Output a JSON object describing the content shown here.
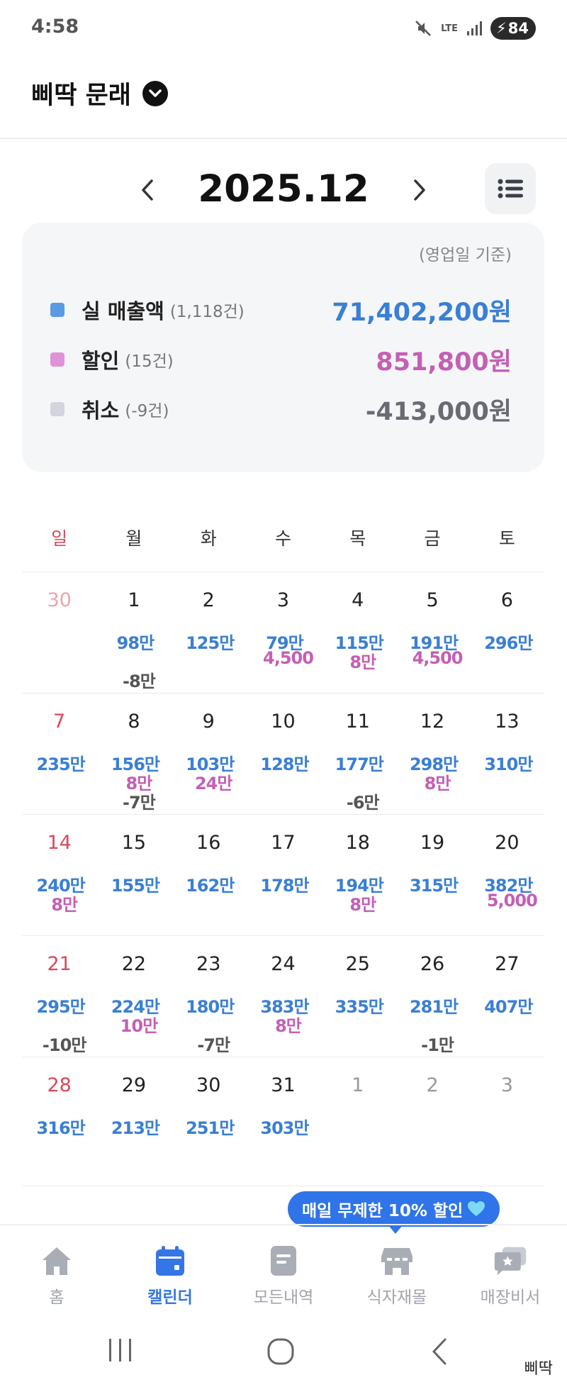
{
  "status": {
    "time": "4:58",
    "network": "LTE",
    "battery": "84"
  },
  "header": {
    "store_name": "삐딱 문래"
  },
  "month_nav": {
    "title": "2025.12"
  },
  "summary": {
    "basis": "(영업일 기준)",
    "rows": [
      {
        "label": "실 매출액",
        "count": "(1,118건)",
        "amount": "71,402,200원",
        "color": "#3a7fd3",
        "swatch": "#5a9be3"
      },
      {
        "label": "할인",
        "count": "(15건)",
        "amount": "851,800원",
        "color": "#c45fb5",
        "swatch": "#e092d6"
      },
      {
        "label": "취소",
        "count": "(-9건)",
        "amount": "-413,000원",
        "color": "#6a6a74",
        "swatch": "#d3d4de"
      }
    ]
  },
  "weekdays": [
    "일",
    "월",
    "화",
    "수",
    "목",
    "금",
    "토"
  ],
  "colors": {
    "sunday": "#d9485b",
    "other_month": "#999999",
    "other_month_sunday": "#f0a3ad"
  },
  "calendar": [
    [
      {
        "day": "30",
        "other": true,
        "sales": "",
        "discount": "",
        "cancel": ""
      },
      {
        "day": "1",
        "sales": "98만",
        "discount": "",
        "cancel": "-8만"
      },
      {
        "day": "2",
        "sales": "125만",
        "discount": "",
        "cancel": ""
      },
      {
        "day": "3",
        "sales": "79만",
        "discount": "4,500",
        "cancel": ""
      },
      {
        "day": "4",
        "sales": "115만",
        "discount": "8만",
        "cancel": ""
      },
      {
        "day": "5",
        "sales": "191만",
        "discount": "4,500",
        "cancel": ""
      },
      {
        "day": "6",
        "sales": "296만",
        "discount": "",
        "cancel": ""
      }
    ],
    [
      {
        "day": "7",
        "sales": "235만",
        "discount": "",
        "cancel": ""
      },
      {
        "day": "8",
        "sales": "156만",
        "discount": "8만",
        "cancel": "-7만"
      },
      {
        "day": "9",
        "sales": "103만",
        "discount": "24만",
        "cancel": ""
      },
      {
        "day": "10",
        "sales": "128만",
        "discount": "",
        "cancel": ""
      },
      {
        "day": "11",
        "sales": "177만",
        "discount": "",
        "cancel": "-6만"
      },
      {
        "day": "12",
        "sales": "298만",
        "discount": "8만",
        "cancel": ""
      },
      {
        "day": "13",
        "sales": "310만",
        "discount": "",
        "cancel": ""
      }
    ],
    [
      {
        "day": "14",
        "sales": "240만",
        "discount": "8만",
        "cancel": ""
      },
      {
        "day": "15",
        "sales": "155만",
        "discount": "",
        "cancel": ""
      },
      {
        "day": "16",
        "sales": "162만",
        "discount": "",
        "cancel": ""
      },
      {
        "day": "17",
        "sales": "178만",
        "discount": "",
        "cancel": ""
      },
      {
        "day": "18",
        "sales": "194만",
        "discount": "8만",
        "cancel": ""
      },
      {
        "day": "19",
        "sales": "315만",
        "discount": "",
        "cancel": ""
      },
      {
        "day": "20",
        "sales": "382만",
        "discount": "5,000",
        "cancel": ""
      }
    ],
    [
      {
        "day": "21",
        "sales": "295만",
        "discount": "",
        "cancel": "-10만"
      },
      {
        "day": "22",
        "sales": "224만",
        "discount": "10만",
        "cancel": ""
      },
      {
        "day": "23",
        "sales": "180만",
        "discount": "",
        "cancel": "-7만"
      },
      {
        "day": "24",
        "sales": "383만",
        "discount": "8만",
        "cancel": ""
      },
      {
        "day": "25",
        "sales": "335만",
        "discount": "",
        "cancel": ""
      },
      {
        "day": "26",
        "sales": "281만",
        "discount": "",
        "cancel": "-1만"
      },
      {
        "day": "27",
        "sales": "407만",
        "discount": "",
        "cancel": ""
      }
    ],
    [
      {
        "day": "28",
        "sales": "316만",
        "discount": "",
        "cancel": ""
      },
      {
        "day": "29",
        "sales": "213만",
        "discount": "",
        "cancel": ""
      },
      {
        "day": "30",
        "sales": "251만",
        "discount": "",
        "cancel": ""
      },
      {
        "day": "31",
        "sales": "303만",
        "discount": "",
        "cancel": ""
      },
      {
        "day": "1",
        "other": true,
        "sales": "",
        "discount": "",
        "cancel": ""
      },
      {
        "day": "2",
        "other": true,
        "sales": "",
        "discount": "",
        "cancel": ""
      },
      {
        "day": "3",
        "other": true,
        "sales": "",
        "discount": "",
        "cancel": ""
      }
    ]
  ],
  "promo": {
    "text": "매일 무제한 10% 할인",
    "icon": "blue-heart-icon"
  },
  "bottom_nav": [
    {
      "label": "홈",
      "icon": "home-icon",
      "active": false
    },
    {
      "label": "캘린더",
      "icon": "calendar-icon",
      "active": true
    },
    {
      "label": "모든내역",
      "icon": "receipt-icon",
      "active": false
    },
    {
      "label": "식자재몰",
      "icon": "store-icon",
      "active": false
    },
    {
      "label": "매장비서",
      "icon": "assistant-chat-icon",
      "active": false
    }
  ],
  "watermark": "삐딱"
}
